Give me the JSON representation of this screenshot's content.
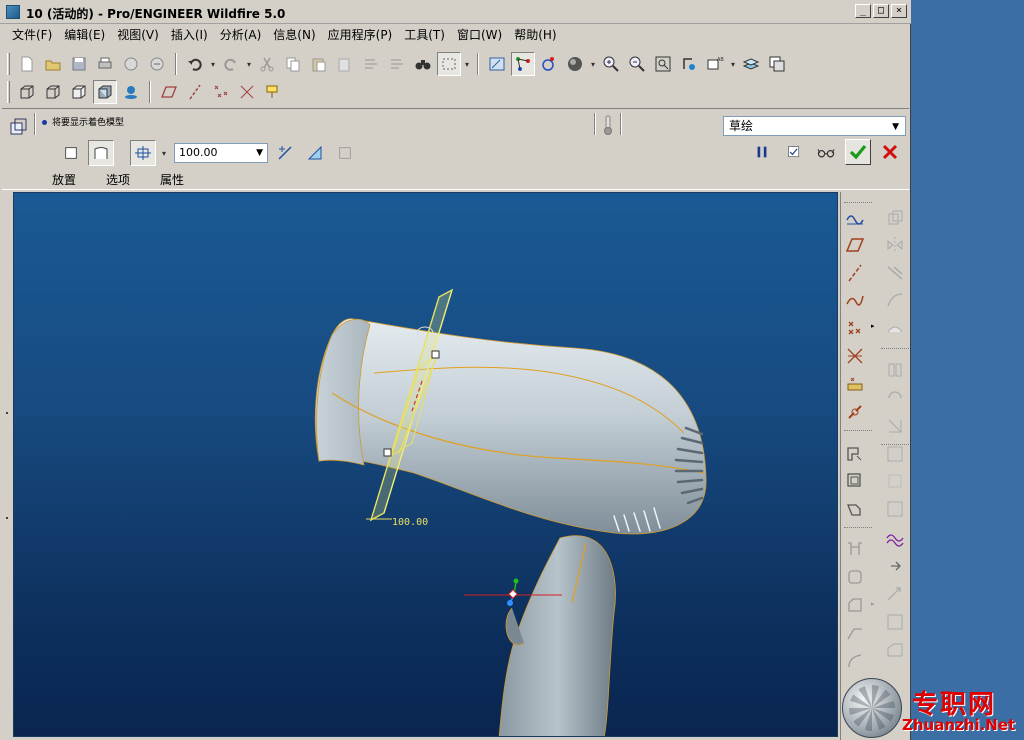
{
  "window": {
    "title": "10 (活动的) - Pro/ENGINEER Wildfire 5.0",
    "minimize": "_",
    "maximize": "□",
    "close": "×"
  },
  "menu": [
    "文件(F)",
    "编辑(E)",
    "视图(V)",
    "插入(I)",
    "分析(A)",
    "信息(N)",
    "应用程序(P)",
    "工具(T)",
    "窗口(W)",
    "帮助(H)"
  ],
  "dashboard": {
    "message": "将要显示着色模型",
    "mode": "草绘",
    "offset_value": "100.00",
    "tabs": [
      "放置",
      "选项",
      "属性"
    ]
  },
  "viewport": {
    "dimension_label": "100.00"
  },
  "watermark": {
    "cn": "专职网",
    "en": "Zhuanzhi.Net"
  },
  "colors": {
    "viewport_top": "#1a5a94",
    "viewport_bottom": "#0a2550",
    "model_surface": "#c5d0d6",
    "edge_highlight": "#e0a020",
    "plane_yellow": "#e8e060",
    "ok_green": "#1a9a1a",
    "cancel_red": "#d01010"
  }
}
